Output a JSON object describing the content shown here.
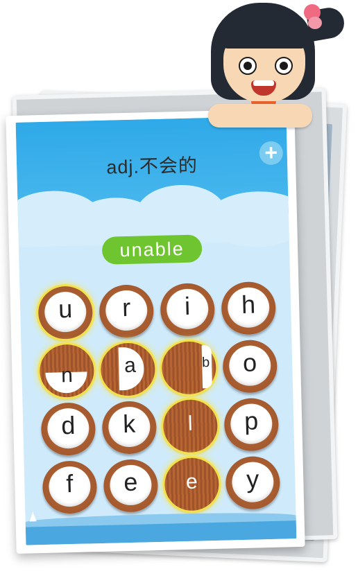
{
  "card": {
    "title": "adj.不会的",
    "plus_label": "+",
    "answer": "unable"
  },
  "grid": {
    "tiles": [
      {
        "letter": "u",
        "state": "selected"
      },
      {
        "letter": "r",
        "state": "normal"
      },
      {
        "letter": "i",
        "state": "normal"
      },
      {
        "letter": "h",
        "state": "normal"
      },
      {
        "letter": "n",
        "state": "selected-flipping"
      },
      {
        "letter": "a",
        "state": "selected-flipping"
      },
      {
        "letter": "b",
        "state": "selected-flipping"
      },
      {
        "letter": "o",
        "state": "normal"
      },
      {
        "letter": "d",
        "state": "normal"
      },
      {
        "letter": "k",
        "state": "normal"
      },
      {
        "letter": "l",
        "state": "selected-flipped"
      },
      {
        "letter": "p",
        "state": "normal"
      },
      {
        "letter": "f",
        "state": "normal"
      },
      {
        "letter": "e",
        "state": "normal"
      },
      {
        "letter": "e",
        "state": "selected-flipped"
      },
      {
        "letter": "y",
        "state": "normal"
      }
    ]
  },
  "colors": {
    "sky": "#2fa9e8",
    "answer_pill": "#6fc52f",
    "tile_shell": "#a45a2e",
    "highlight": "#f4e24a"
  }
}
